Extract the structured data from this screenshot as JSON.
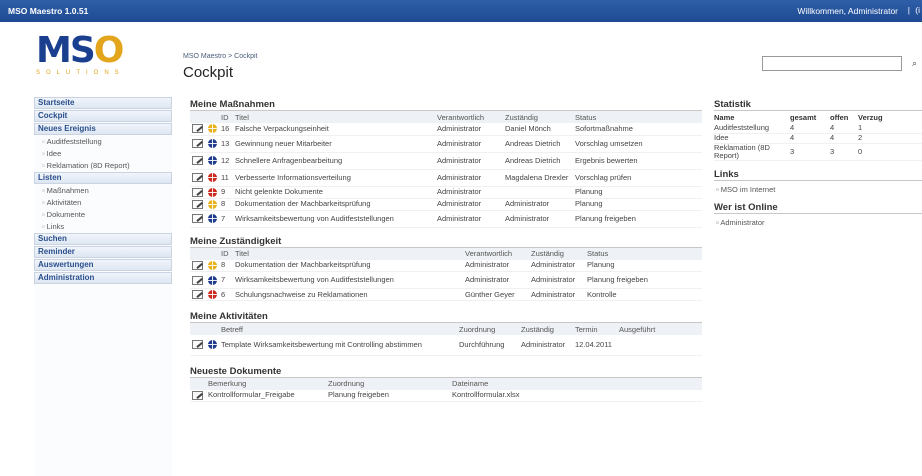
{
  "topbar": {
    "app_title": "MSO Maestro 1.0.51",
    "welcome": "Willkommen, Administrator",
    "separator": "|",
    "extra": "(i"
  },
  "logo": {
    "m": "M",
    "s": "S",
    "o": "O",
    "sub": "SOLUTIONS"
  },
  "header": {
    "breadcrumb": "MSO Maestro > Cockpit",
    "title": "Cockpit",
    "search_value": ""
  },
  "colors": {
    "topbar": "#1d4a93",
    "accent": "#2a4f8c",
    "ball_yellow": "#e8b21c",
    "ball_blue": "#1f3c8e",
    "ball_red": "#cc2a1e"
  },
  "sidebar": {
    "items": [
      {
        "type": "main",
        "label": "Startseite"
      },
      {
        "type": "main",
        "label": "Cockpit"
      },
      {
        "type": "main",
        "label": "Neues Ereignis"
      },
      {
        "type": "sub",
        "label": "Auditfeststellung"
      },
      {
        "type": "sub",
        "label": "Idee"
      },
      {
        "type": "sub",
        "label": "Reklamation (8D Report)"
      },
      {
        "type": "main",
        "label": "Listen"
      },
      {
        "type": "sub",
        "label": "Maßnahmen"
      },
      {
        "type": "sub",
        "label": "Aktivitäten"
      },
      {
        "type": "sub",
        "label": "Dokumente"
      },
      {
        "type": "sub",
        "label": "Links"
      },
      {
        "type": "main",
        "label": "Suchen"
      },
      {
        "type": "main",
        "label": "Reminder"
      },
      {
        "type": "main",
        "label": "Auswertungen"
      },
      {
        "type": "main",
        "label": "Administration"
      }
    ]
  },
  "massnahmen": {
    "title": "Meine Maßnahmen",
    "headers": [
      "ID",
      "Titel",
      "Verantwortlich",
      "Zuständig",
      "Status"
    ],
    "rows": [
      {
        "ball": "yellow",
        "id": "16",
        "title": "Falsche Verpackungseinheit",
        "verantwortlich": "Administrator",
        "zustaendig": "Daniel Mönch",
        "status": "Sofortmaßnahme"
      },
      {
        "ball": "blue",
        "id": "13",
        "title": "Gewinnung neuer Mitarbeiter",
        "verantwortlich": "Administrator",
        "zustaendig": "Andreas Dietrich",
        "status": "Vorschlag umsetzen"
      },
      {
        "ball": "blue",
        "id": "12",
        "title": "Schnellere Anfragenbearbeitung",
        "verantwortlich": "Administrator",
        "zustaendig": "Andreas Dietrich",
        "status": "Ergebnis bewerten"
      },
      {
        "ball": "red",
        "id": "11",
        "title": "Verbesserte Informationsverteilung",
        "verantwortlich": "Administrator",
        "zustaendig": "Magdalena Drexler",
        "status": "Vorschlag prüfen"
      },
      {
        "ball": "red",
        "id": "9",
        "title": "Nicht gelenkte Dokumente",
        "verantwortlich": "Administrator",
        "zustaendig": "",
        "status": "Planung"
      },
      {
        "ball": "yellow",
        "id": "8",
        "title": "Dokumentation der Machbarkeitsprüfung",
        "verantwortlich": "Administrator",
        "zustaendig": "Administrator",
        "status": "Planung"
      },
      {
        "ball": "blue",
        "id": "7",
        "title": "Wirksamkeitsbewertung von Auditfeststellungen",
        "verantwortlich": "Administrator",
        "zustaendig": "Administrator",
        "status": "Planung freigeben"
      }
    ]
  },
  "zustaendigkeit": {
    "title": "Meine Zuständigkeit",
    "headers": [
      "ID",
      "Titel",
      "Verantwortlich",
      "Zuständig",
      "Status"
    ],
    "rows": [
      {
        "ball": "yellow",
        "id": "8",
        "title": "Dokumentation der Machbarkeitsprüfung",
        "verantwortlich": "Administrator",
        "zustaendig": "Administrator",
        "status": "Planung"
      },
      {
        "ball": "blue",
        "id": "7",
        "title": "Wirksamkeitsbewertung von Auditfeststellungen",
        "verantwortlich": "Administrator",
        "zustaendig": "Administrator",
        "status": "Planung freigeben"
      },
      {
        "ball": "red",
        "id": "6",
        "title": "Schulungsnachweise zu Reklamationen",
        "verantwortlich": "Günther Geyer",
        "zustaendig": "Administrator",
        "status": "Kontrolle"
      }
    ]
  },
  "aktivitaeten": {
    "title": "Meine Aktivitäten",
    "headers": [
      "Betreff",
      "Zuordnung",
      "Zuständig",
      "Termin",
      "Ausgeführt"
    ],
    "rows": [
      {
        "ball": "blue",
        "betreff": "Template Wirksamkeitsbewertung mit Controlling abstimmen",
        "zuordnung": "Durchführung",
        "zustaendig": "Administrator",
        "termin": "12.04.2011",
        "ausgefuehrt": ""
      }
    ]
  },
  "dokumente": {
    "title": "Neueste Dokumente",
    "headers": [
      "Bemerkung",
      "Zuordnung",
      "Dateiname"
    ],
    "rows": [
      {
        "bemerkung": "Kontrollformular_Freigabe",
        "zuordnung": "Planung freigeben",
        "dateiname": "Kontrollformular.xlsx"
      }
    ]
  },
  "statistik": {
    "title": "Statistik",
    "headers": [
      "Name",
      "gesamt",
      "offen",
      "Verzug"
    ],
    "rows": [
      {
        "name": "Auditfeststellung",
        "gesamt": "4",
        "offen": "4",
        "verzug": "1"
      },
      {
        "name": "Idee",
        "gesamt": "4",
        "offen": "4",
        "verzug": "2"
      },
      {
        "name": "Reklamation (8D Report)",
        "gesamt": "3",
        "offen": "3",
        "verzug": "0"
      }
    ]
  },
  "links": {
    "title": "Links",
    "items": [
      "MSO im Internet"
    ]
  },
  "online": {
    "title": "Wer ist Online",
    "items": [
      "Administrator"
    ]
  }
}
